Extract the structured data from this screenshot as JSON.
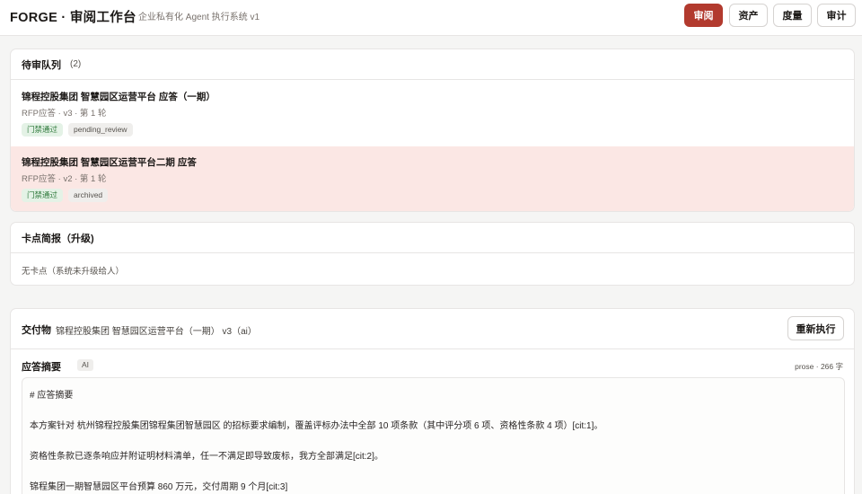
{
  "header": {
    "brand": "FORGE · 审阅工作台",
    "subtitle": "企业私有化 Agent 执行系统 v1",
    "nav": [
      {
        "label": "审阅",
        "active": true
      },
      {
        "label": "资产",
        "active": false
      },
      {
        "label": "度量",
        "active": false
      },
      {
        "label": "审计",
        "active": false
      }
    ]
  },
  "queue": {
    "title": "待审队列",
    "count": "(2)",
    "items": [
      {
        "title": "锦程控股集团 智慧园区运营平台 应答（一期）",
        "meta": "RFP应答 · v3 · 第 1 轮",
        "tags": [
          "门禁通过",
          "pending_review"
        ],
        "selected": false
      },
      {
        "title": "锦程控股集团 智慧园区运营平台二期 应答",
        "meta": "RFP应答 · v2 · 第 1 轮",
        "tags": [
          "门禁通过",
          "archived"
        ],
        "selected": true
      }
    ]
  },
  "blockers": {
    "title": "卡点简报（升级)",
    "empty_text": "无卡点（系统未升级给人）"
  },
  "deliverable": {
    "label": "交付物",
    "name": "锦程控股集团 智慧园区运营平台（一期） v3（ai）",
    "rerun_label": "重新执行",
    "section_title": "应答摘要",
    "ai_badge": "AI",
    "meta": "prose · 266 字",
    "content_lines": [
      "# 应答摘要",
      "本方案针对 杭州锦程控股集团锦程集团智慧园区 的招标要求编制，覆盖评标办法中全部 10 项条款（其中评分项 6 项、资格性条款 4 项）[cit:1]。",
      "资格性条款已逐条响应并附证明材料清单，任一不满足即导致废标，我方全部满足[cit:2]。",
      "锦程集团一期智慧园区平台预算 860 万元，交付周期 9 个月[cit:3]"
    ]
  },
  "colors": {
    "accent": "#b23a2e",
    "selected_row": "#fbe7e4",
    "tag_green_bg": "#e4f2e6",
    "tag_green_text": "#2f7a3c"
  }
}
